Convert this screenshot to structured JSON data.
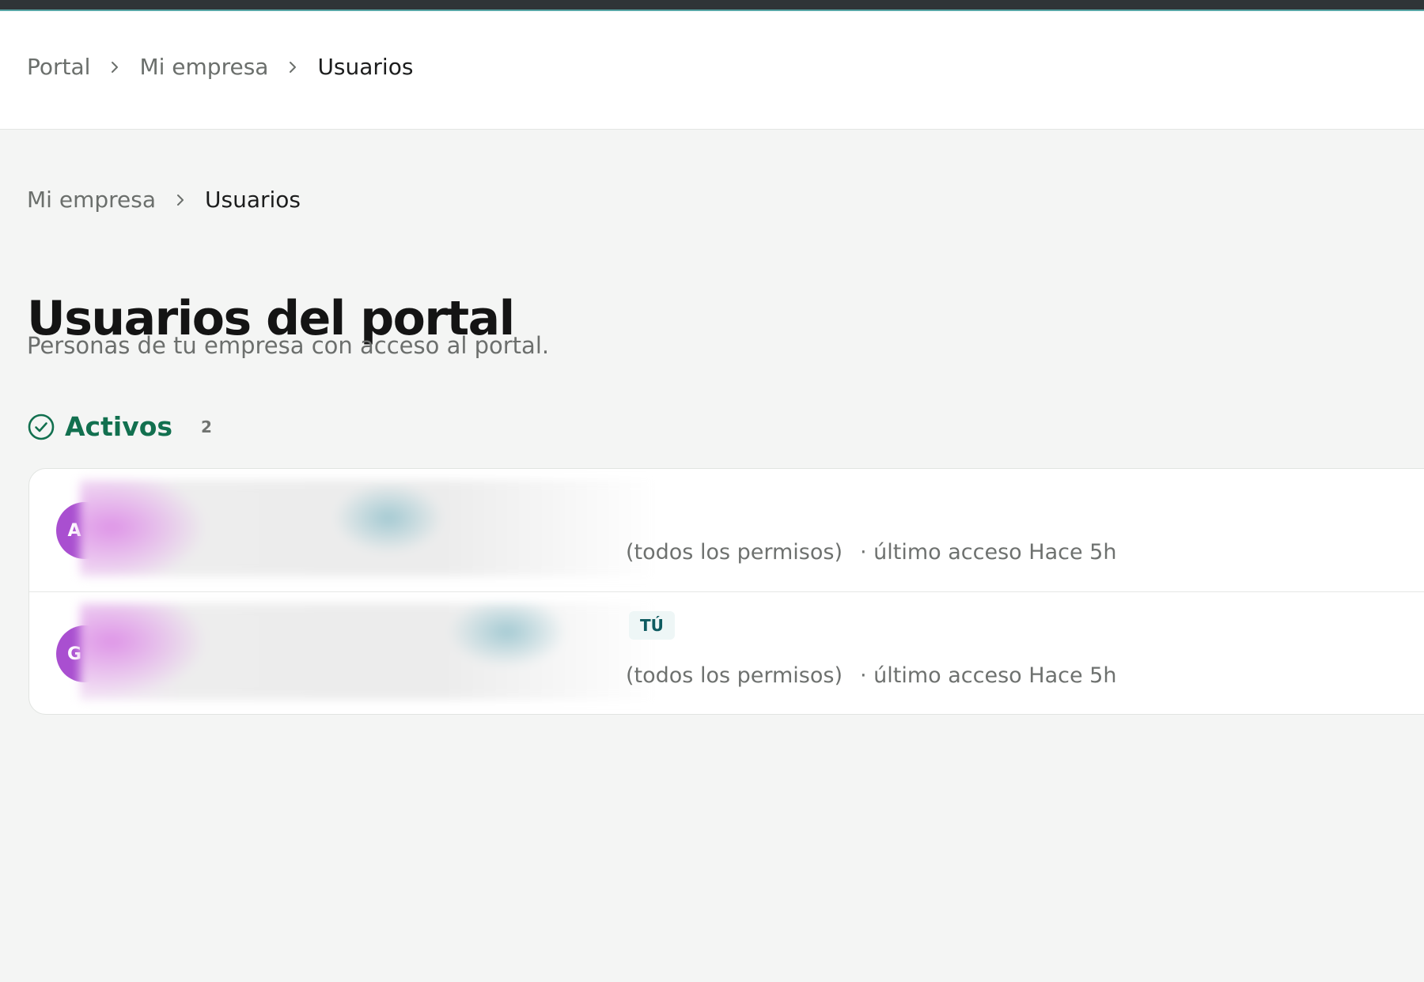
{
  "colors": {
    "accent_green": "#12704f",
    "avatar_purple": "#a94fd0",
    "badge_bg": "#eef6f6",
    "badge_text": "#0e5b60"
  },
  "topbar": {
    "breadcrumb": [
      "Portal",
      "Mi empresa",
      "Usuarios"
    ]
  },
  "page": {
    "breadcrumb": [
      "Mi empresa",
      "Usuarios"
    ],
    "title": "Usuarios del portal",
    "subtitle": "Personas de tu empresa con acceso al portal."
  },
  "section": {
    "icon": "check-circle-icon",
    "label": "Activos",
    "count": "2"
  },
  "users": [
    {
      "avatar_initial": "A",
      "role": "(todos los permisos)",
      "last_access": "· último acceso Hace 5h",
      "badge": ""
    },
    {
      "avatar_initial": "G",
      "role": "(todos los permisos)",
      "last_access": "· último acceso Hace 5h",
      "badge": "TÚ"
    }
  ]
}
